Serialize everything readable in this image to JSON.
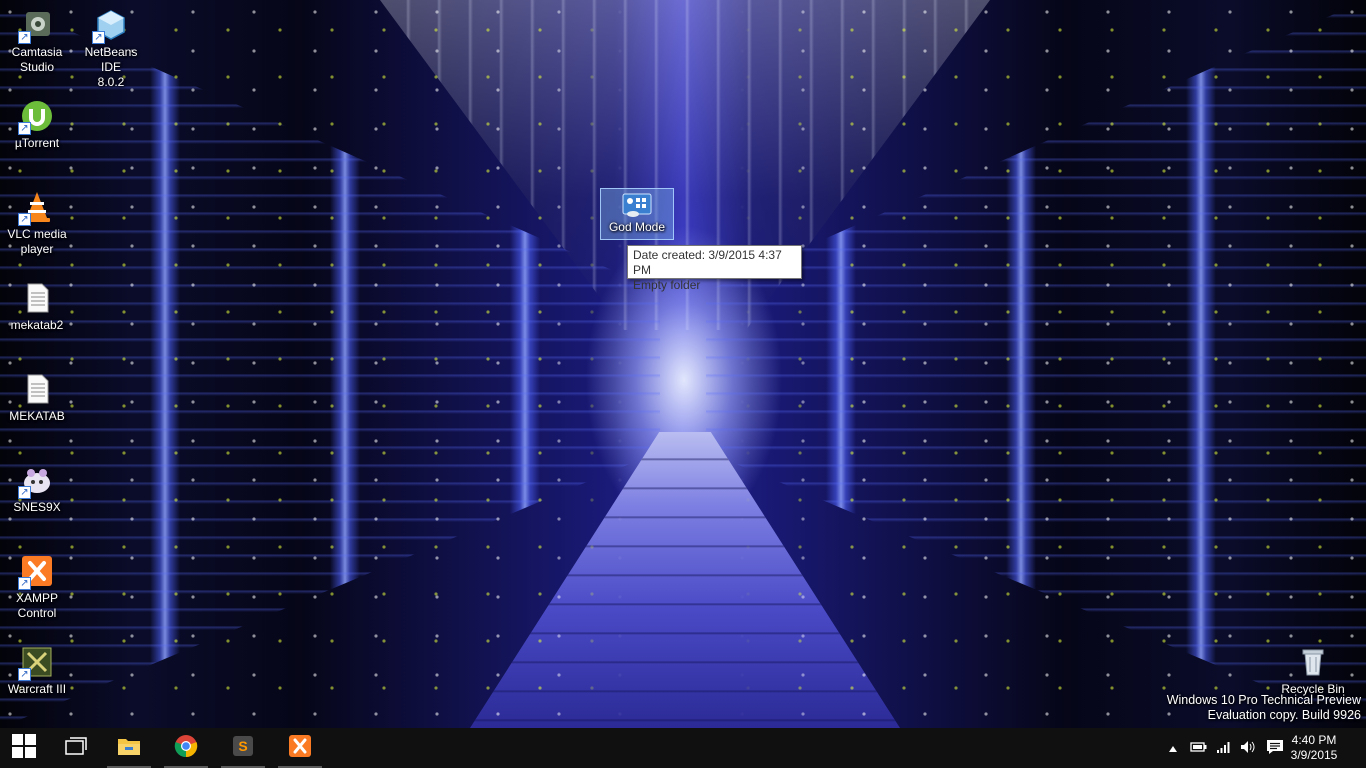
{
  "desktop": {
    "icons": [
      {
        "label_line1": "Camtasia",
        "label_line2": "Studio",
        "icon": "camtasia-icon"
      },
      {
        "label_line1": "NetBeans IDE",
        "label_line2": "8.0.2",
        "icon": "netbeans-icon"
      },
      {
        "label_line1": "µTorrent",
        "label_line2": "",
        "icon": "utorrent-icon"
      },
      {
        "label_line1": "VLC media",
        "label_line2": "player",
        "icon": "vlc-icon"
      },
      {
        "label_line1": "mekatab2",
        "label_line2": "",
        "icon": "text-file-icon"
      },
      {
        "label_line1": "MEKATAB",
        "label_line2": "",
        "icon": "text-file-icon"
      },
      {
        "label_line1": "SNES9X",
        "label_line2": "",
        "icon": "snes9x-icon"
      },
      {
        "label_line1": "XAMPP",
        "label_line2": "Control",
        "icon": "xampp-icon"
      },
      {
        "label_line1": "Warcraft III",
        "label_line2": "",
        "icon": "warcraft-icon"
      },
      {
        "label_line1": "Recycle Bin",
        "label_line2": "",
        "icon": "recycle-bin-icon"
      }
    ],
    "selected_icon": {
      "label": "God Mode",
      "icon": "control-panel-icon"
    },
    "tooltip": {
      "line1": "Date created: 3/9/2015 4:37 PM",
      "line2": "Empty folder"
    },
    "watermark": {
      "line1": "Windows 10 Pro Technical Preview",
      "line2": "Evaluation copy. Build 9926"
    }
  },
  "taskbar": {
    "buttons": [
      {
        "name": "start-button",
        "icon": "windows-logo-icon"
      },
      {
        "name": "task-view-button",
        "icon": "task-view-icon"
      },
      {
        "name": "file-explorer-button",
        "icon": "folder-icon"
      },
      {
        "name": "chrome-button",
        "icon": "chrome-icon"
      },
      {
        "name": "sublime-text-button",
        "icon": "sublime-text-icon"
      },
      {
        "name": "xampp-button",
        "icon": "xampp-icon"
      }
    ],
    "tray": {
      "icons": [
        "chevron-up-icon",
        "power-icon",
        "network-icon",
        "volume-icon",
        "action-center-icon"
      ]
    },
    "clock": {
      "time": "4:40 PM",
      "date": "3/9/2015"
    }
  },
  "colors": {
    "taskbar": "#101010",
    "selection": "#78aae6",
    "xampp_orange": "#fb7a24",
    "folder_yellow": "#f4c542"
  }
}
